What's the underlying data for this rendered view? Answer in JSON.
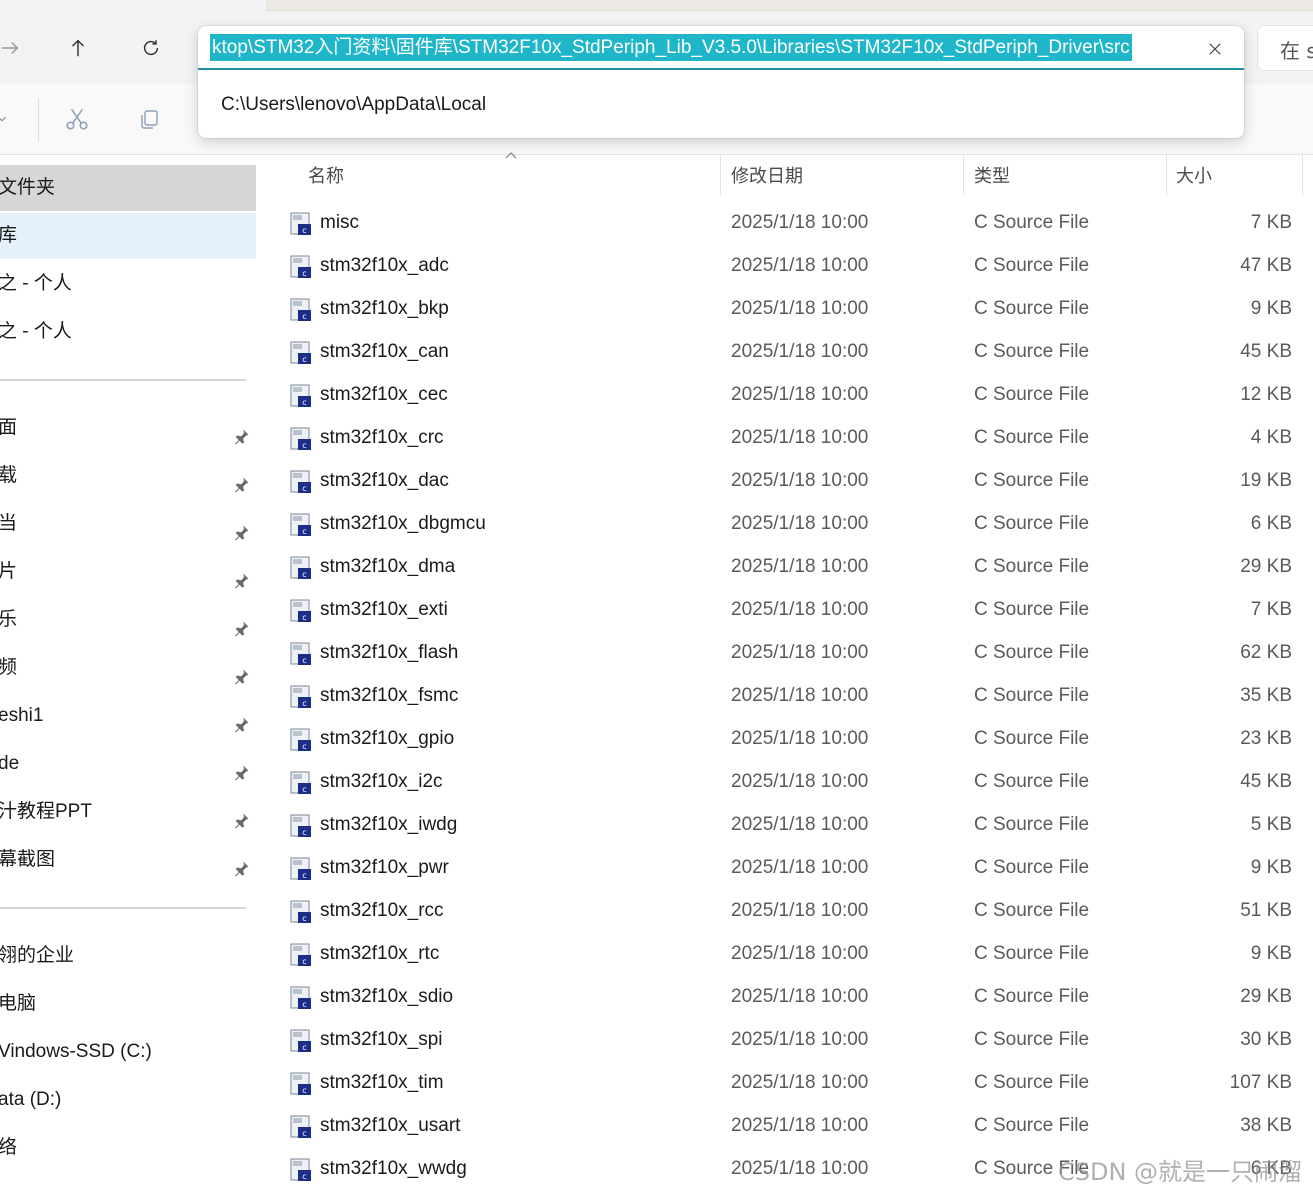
{
  "address_bar": {
    "current_path": "ktop\\STM32入门资料\\固件库\\STM32F10x_StdPeriph_Lib_V3.5.0\\Libraries\\STM32F10x_StdPeriph_Driver\\src",
    "suggestion": "C:\\Users\\lenovo\\AppData\\Local"
  },
  "search": {
    "placeholder_visible": "在 s"
  },
  "icons": {
    "forward": "arrow-right-icon",
    "up": "arrow-up-icon",
    "refresh": "refresh-icon",
    "clear": "close-icon",
    "cut": "scissors-icon",
    "copy": "copy-icon",
    "pin": "pin-icon",
    "file": "c-source-file-icon"
  },
  "colors": {
    "selection": "#1fb6c9",
    "accent": "#1f8fa8",
    "sidebar_selected": "#d6d6d6",
    "sidebar_highlight": "#e6f1fb"
  },
  "sidebar": {
    "top_items": [
      {
        "label": "文件夹"
      },
      {
        "label": "库"
      },
      {
        "label": "之 - 个人"
      },
      {
        "label": "之 - 个人"
      }
    ],
    "pinned_items": [
      {
        "label": "面"
      },
      {
        "label": "载"
      },
      {
        "label": "当"
      },
      {
        "label": "片"
      },
      {
        "label": "乐"
      },
      {
        "label": "频"
      },
      {
        "label": "eshi1"
      },
      {
        "label": "de"
      },
      {
        "label": "汁教程PPT"
      },
      {
        "label": "幕截图"
      }
    ],
    "drive_items": [
      {
        "label": "翎的企业"
      },
      {
        "label": "电脑"
      },
      {
        "label": "Vindows-SSD (C:)"
      },
      {
        "label": "ata (D:)"
      },
      {
        "label": "络"
      }
    ]
  },
  "columns": {
    "name": "名称",
    "date": "修改日期",
    "type": "类型",
    "size": "大小"
  },
  "files": [
    {
      "name": "misc",
      "date": "2025/1/18 10:00",
      "type": "C Source File",
      "size": "7 KB"
    },
    {
      "name": "stm32f10x_adc",
      "date": "2025/1/18 10:00",
      "type": "C Source File",
      "size": "47 KB"
    },
    {
      "name": "stm32f10x_bkp",
      "date": "2025/1/18 10:00",
      "type": "C Source File",
      "size": "9 KB"
    },
    {
      "name": "stm32f10x_can",
      "date": "2025/1/18 10:00",
      "type": "C Source File",
      "size": "45 KB"
    },
    {
      "name": "stm32f10x_cec",
      "date": "2025/1/18 10:00",
      "type": "C Source File",
      "size": "12 KB"
    },
    {
      "name": "stm32f10x_crc",
      "date": "2025/1/18 10:00",
      "type": "C Source File",
      "size": "4 KB"
    },
    {
      "name": "stm32f10x_dac",
      "date": "2025/1/18 10:00",
      "type": "C Source File",
      "size": "19 KB"
    },
    {
      "name": "stm32f10x_dbgmcu",
      "date": "2025/1/18 10:00",
      "type": "C Source File",
      "size": "6 KB"
    },
    {
      "name": "stm32f10x_dma",
      "date": "2025/1/18 10:00",
      "type": "C Source File",
      "size": "29 KB"
    },
    {
      "name": "stm32f10x_exti",
      "date": "2025/1/18 10:00",
      "type": "C Source File",
      "size": "7 KB"
    },
    {
      "name": "stm32f10x_flash",
      "date": "2025/1/18 10:00",
      "type": "C Source File",
      "size": "62 KB"
    },
    {
      "name": "stm32f10x_fsmc",
      "date": "2025/1/18 10:00",
      "type": "C Source File",
      "size": "35 KB"
    },
    {
      "name": "stm32f10x_gpio",
      "date": "2025/1/18 10:00",
      "type": "C Source File",
      "size": "23 KB"
    },
    {
      "name": "stm32f10x_i2c",
      "date": "2025/1/18 10:00",
      "type": "C Source File",
      "size": "45 KB"
    },
    {
      "name": "stm32f10x_iwdg",
      "date": "2025/1/18 10:00",
      "type": "C Source File",
      "size": "5 KB"
    },
    {
      "name": "stm32f10x_pwr",
      "date": "2025/1/18 10:00",
      "type": "C Source File",
      "size": "9 KB"
    },
    {
      "name": "stm32f10x_rcc",
      "date": "2025/1/18 10:00",
      "type": "C Source File",
      "size": "51 KB"
    },
    {
      "name": "stm32f10x_rtc",
      "date": "2025/1/18 10:00",
      "type": "C Source File",
      "size": "9 KB"
    },
    {
      "name": "stm32f10x_sdio",
      "date": "2025/1/18 10:00",
      "type": "C Source File",
      "size": "29 KB"
    },
    {
      "name": "stm32f10x_spi",
      "date": "2025/1/18 10:00",
      "type": "C Source File",
      "size": "30 KB"
    },
    {
      "name": "stm32f10x_tim",
      "date": "2025/1/18 10:00",
      "type": "C Source File",
      "size": "107 KB"
    },
    {
      "name": "stm32f10x_usart",
      "date": "2025/1/18 10:00",
      "type": "C Source File",
      "size": "38 KB"
    },
    {
      "name": "stm32f10x_wwdg",
      "date": "2025/1/18 10:00",
      "type": "C Source File",
      "size": "6 KB"
    }
  ],
  "watermark": "CSDN @就是一只闹溜"
}
